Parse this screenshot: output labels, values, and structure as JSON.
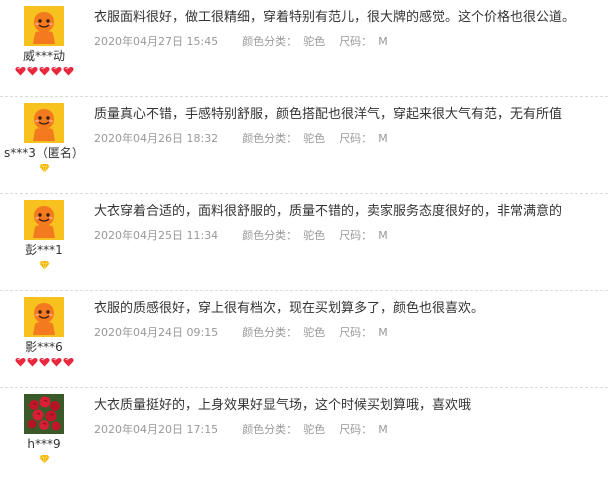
{
  "reviews": [
    {
      "username": "威***动",
      "avatar": "tmall-mascot-avatar",
      "badge": "red-heart",
      "badge_count": 5,
      "content": "衣服面料很好，做工很精细，穿着特别有范儿，很大牌的感觉。这个价格也很公道。",
      "date": "2020年04月27日 15:45",
      "color_label": "颜色分类：",
      "color_value": "驼色",
      "size_label": "尺码：",
      "size_value": "M"
    },
    {
      "username": "s***3（匿名）",
      "avatar": "tmall-mascot-avatar",
      "badge": "yellow-diamond",
      "badge_count": 1,
      "content": "质量真心不错，手感特别舒服，颜色搭配也很洋气，穿起来很大气有范，无有所值",
      "date": "2020年04月26日 18:32",
      "color_label": "颜色分类：",
      "color_value": "驼色",
      "size_label": "尺码：",
      "size_value": "M"
    },
    {
      "username": "彭***1",
      "avatar": "tmall-mascot-avatar",
      "badge": "yellow-diamond",
      "badge_count": 1,
      "content": "大衣穿着合适的，面料很舒服的，质量不错的，卖家服务态度很好的，非常满意的",
      "date": "2020年04月25日 11:34",
      "color_label": "颜色分类：",
      "color_value": "驼色",
      "size_label": "尺码：",
      "size_value": "M"
    },
    {
      "username": "影***6",
      "avatar": "tmall-mascot-avatar",
      "badge": "red-heart",
      "badge_count": 5,
      "content": "衣服的质感很好，穿上很有档次，现在买划算多了，颜色也很喜欢。",
      "date": "2020年04月24日 09:15",
      "color_label": "颜色分类：",
      "color_value": "驼色",
      "size_label": "尺码：",
      "size_value": "M"
    },
    {
      "username": "h***9",
      "avatar": "rose-bouquet-avatar",
      "badge": "yellow-diamond",
      "badge_count": 1,
      "content": "大衣质量挺好的，上身效果好显气场，这个时候买划算哦，喜欢哦",
      "date": "2020年04月20日 17:15",
      "color_label": "颜色分类：",
      "color_value": "驼色",
      "size_label": "尺码：",
      "size_value": "M"
    }
  ],
  "colors": {
    "text": "#333333",
    "meta": "#999999",
    "divider": "#dcdcdc",
    "heart": "#e8263c",
    "diamond": "#f5b400",
    "mascot_bg": "#f7c21d",
    "mascot_body": "#f47a20"
  }
}
